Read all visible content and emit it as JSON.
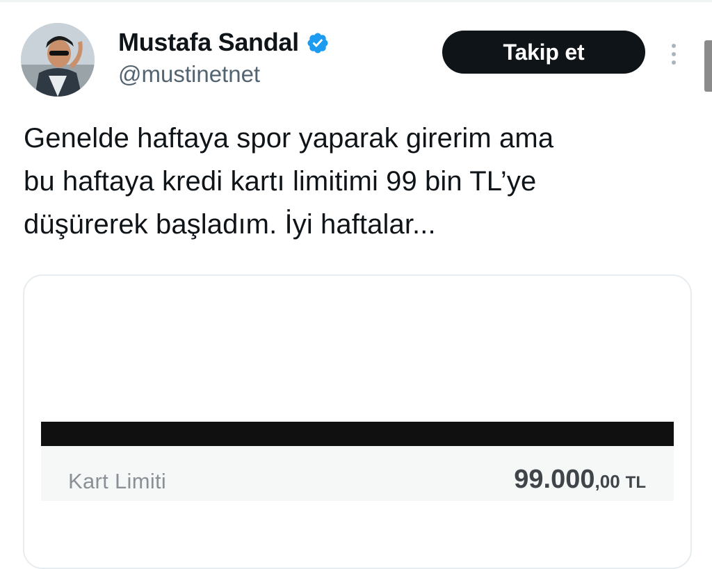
{
  "tweet": {
    "author": {
      "display_name": "Mustafa Sandal",
      "handle": "@mustinetnet",
      "verified": true
    },
    "follow_label": "Takip et",
    "text_lines": [
      "Genelde haftaya spor yaparak girerim ama",
      "bu haftaya kredi kartı limitimi 99 bin TL’ye",
      "düşürerek başladım. İyi haftalar..."
    ],
    "media": {
      "label": "Kart Limiti",
      "value_integer": "99.000",
      "value_decimal": ",00",
      "value_currency": "TL"
    }
  },
  "colors": {
    "verified_badge": "#1d9bf0",
    "follow_button_bg": "#0f1419",
    "handle_text": "#536471"
  },
  "icons": {
    "verified": "verified-badge-icon",
    "more": "more-vertical-icon"
  }
}
